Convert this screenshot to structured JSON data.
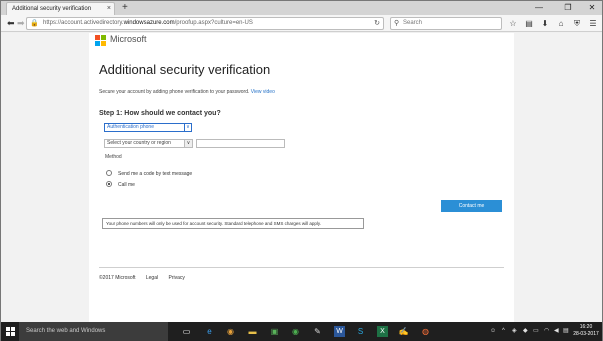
{
  "browser": {
    "tab_title": "Additional security verification",
    "tab_close": "×",
    "new_tab": "+",
    "url_prefix": "https://account.activedirectory.",
    "url_host": "windowsazure.com",
    "url_suffix": "/proofup.aspx?culture=en-US",
    "search_placeholder": "Search"
  },
  "page": {
    "brand": "Microsoft",
    "title": "Additional security verification",
    "description": "Secure your account by adding phone verification to your password.",
    "view_video": "View video",
    "step1_heading": "Step 1: How should we contact you?",
    "contact_method_select": "Authentication phone",
    "country_select": "Select your country or region",
    "phone_value": "",
    "method_label": "Method",
    "option_text": "Send me a code by text message",
    "option_call": "Call me",
    "selected_option": "Call me",
    "contact_button": "Contact me",
    "note": "Your phone numbers will only be used for account security. Standard telephone and SMS charges will apply.",
    "footer": {
      "copyright": "©2017 Microsoft",
      "legal": "Legal",
      "privacy": "Privacy"
    },
    "logo_colors": [
      "#f25022",
      "#7fba00",
      "#00a4ef",
      "#ffb900"
    ],
    "accent_color": "#2b8fd6"
  },
  "taskbar": {
    "search_placeholder": "Search the web and Windows",
    "time": "16:20",
    "date": "28-03-2017"
  }
}
